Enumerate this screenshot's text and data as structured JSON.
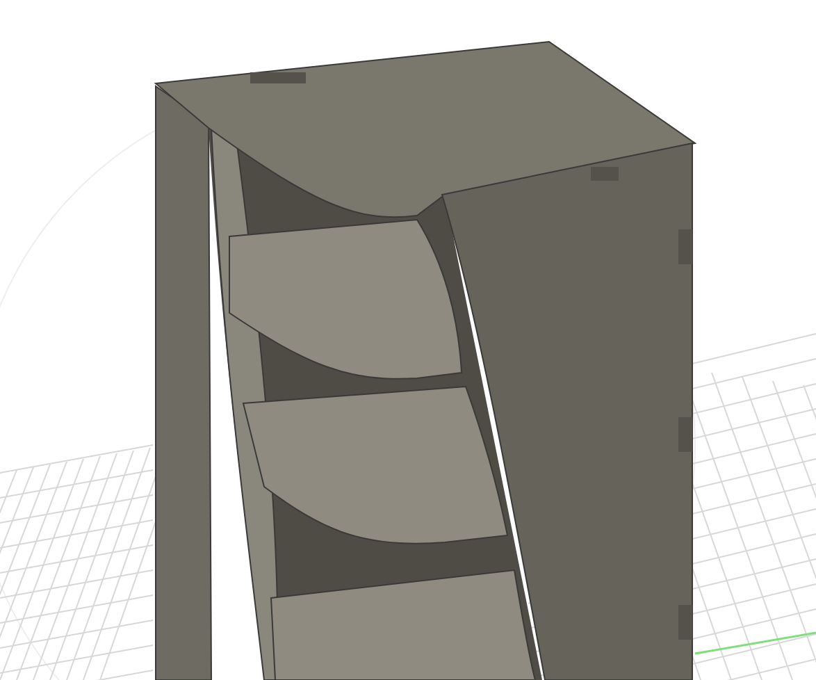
{
  "viewport": {
    "ground_grid": {
      "visible": true
    },
    "model": {
      "kind": "shelf"
    }
  }
}
